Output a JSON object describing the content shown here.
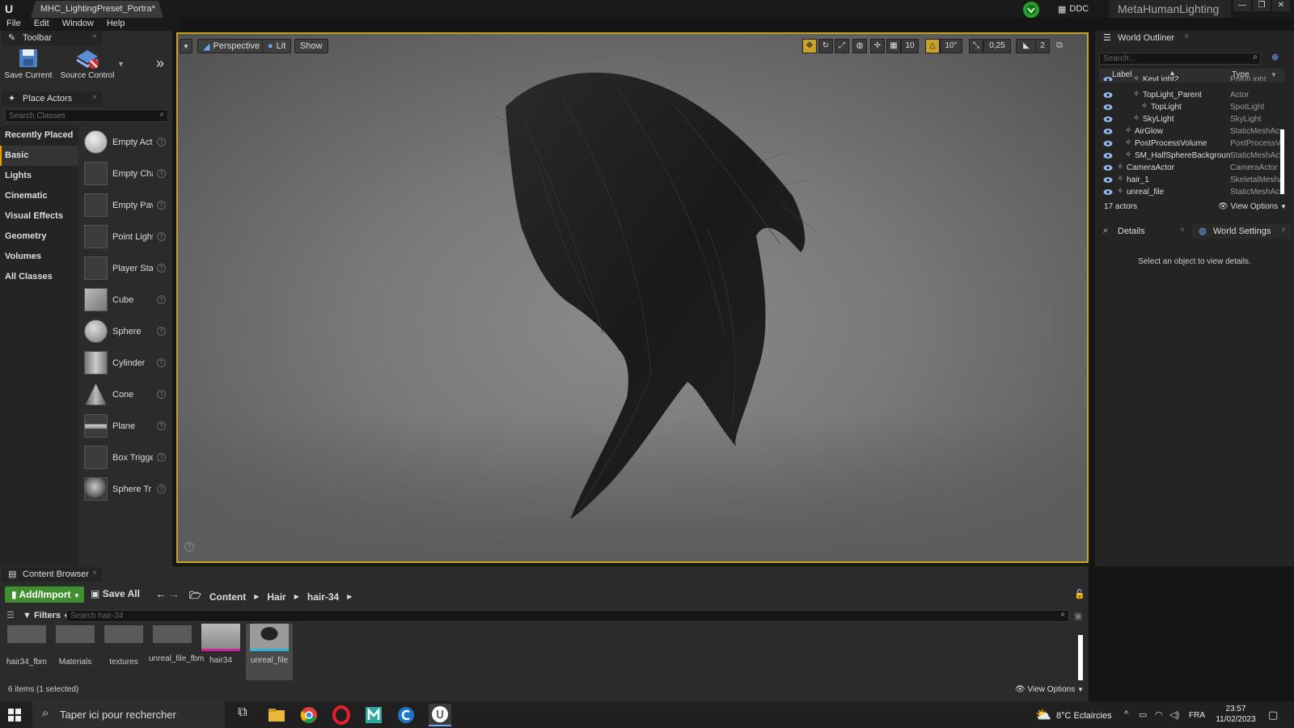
{
  "window": {
    "doc_tab": "MHC_LightingPreset_Portra*",
    "ddc_label": "DDC",
    "project_name": "MetaHumanLighting",
    "menu": [
      "File",
      "Edit",
      "Window",
      "Help"
    ]
  },
  "toolbar": {
    "tab_label": "Toolbar",
    "save_current": "Save Current",
    "source_control": "Source Control"
  },
  "place_actors": {
    "tab_label": "Place Actors",
    "search_placeholder": "Search Classes",
    "categories": [
      "Recently Placed",
      "Basic",
      "Lights",
      "Cinematic",
      "Visual Effects",
      "Geometry",
      "Volumes",
      "All Classes"
    ],
    "active_category": "Basic",
    "actors": [
      "Empty Act",
      "Empty Cha",
      "Empty Pav",
      "Point Light",
      "Player Sta",
      "Cube",
      "Sphere",
      "Cylinder",
      "Cone",
      "Plane",
      "Box Trigge",
      "Sphere Tr"
    ]
  },
  "viewport": {
    "perspective": "Perspective",
    "lit": "Lit",
    "show": "Show",
    "grid_snap": "10",
    "rotation_snap": "10°",
    "scale_snap": "0,25",
    "camera_speed": "2"
  },
  "outliner": {
    "tab_label": "World Outliner",
    "search_placeholder": "Search...",
    "col_label": "Label",
    "col_type": "Type",
    "rows": [
      {
        "name": "KeyLight2",
        "type": "PointLight",
        "indent": 3
      },
      {
        "name": "TopLight_Parent",
        "type": "Actor",
        "indent": 3
      },
      {
        "name": "TopLight",
        "type": "SpotLight",
        "indent": 4
      },
      {
        "name": "SkyLight",
        "type": "SkyLight",
        "indent": 3
      },
      {
        "name": "AirGlow",
        "type": "StaticMeshActor",
        "indent": 2
      },
      {
        "name": "PostProcessVolume",
        "type": "PostProcessVolume",
        "indent": 2
      },
      {
        "name": "SM_HalfSphereBackground",
        "type": "StaticMeshActor",
        "indent": 2
      },
      {
        "name": "CameraActor",
        "type": "CameraActor",
        "indent": 1
      },
      {
        "name": "hair_1",
        "type": "SkeletalMeshActor",
        "indent": 1
      },
      {
        "name": "unreal_file",
        "type": "StaticMeshActor",
        "indent": 1
      }
    ],
    "actor_count": "17 actors",
    "view_options": "View Options"
  },
  "details": {
    "tab_details": "Details",
    "tab_world_settings": "World Settings",
    "empty_msg": "Select an object to view details."
  },
  "content_browser": {
    "tab_label": "Content Browser",
    "add_import": "Add/Import",
    "save_all": "Save All",
    "breadcrumbs": [
      "Content",
      "Hair",
      "hair-34"
    ],
    "filters": "Filters",
    "search_placeholder": "Search hair-34",
    "assets": [
      "hair34_fbm",
      "Materials",
      "textures",
      "unreal_file_fbm",
      "hair34",
      "unreal_file"
    ],
    "item_count": "6 items (1 selected)",
    "view_options": "View Options"
  },
  "taskbar": {
    "search_placeholder": "Taper ici pour rechercher",
    "weather": "8°C  Eclaircies",
    "language": "FRA",
    "time": "23:57",
    "date": "11/02/2023"
  },
  "colors": {
    "accent": "#c9a226",
    "add_import": "#3f8f2f",
    "selection_highlight": "#2bb5d8",
    "magenta_badge": "#d31ea0"
  }
}
